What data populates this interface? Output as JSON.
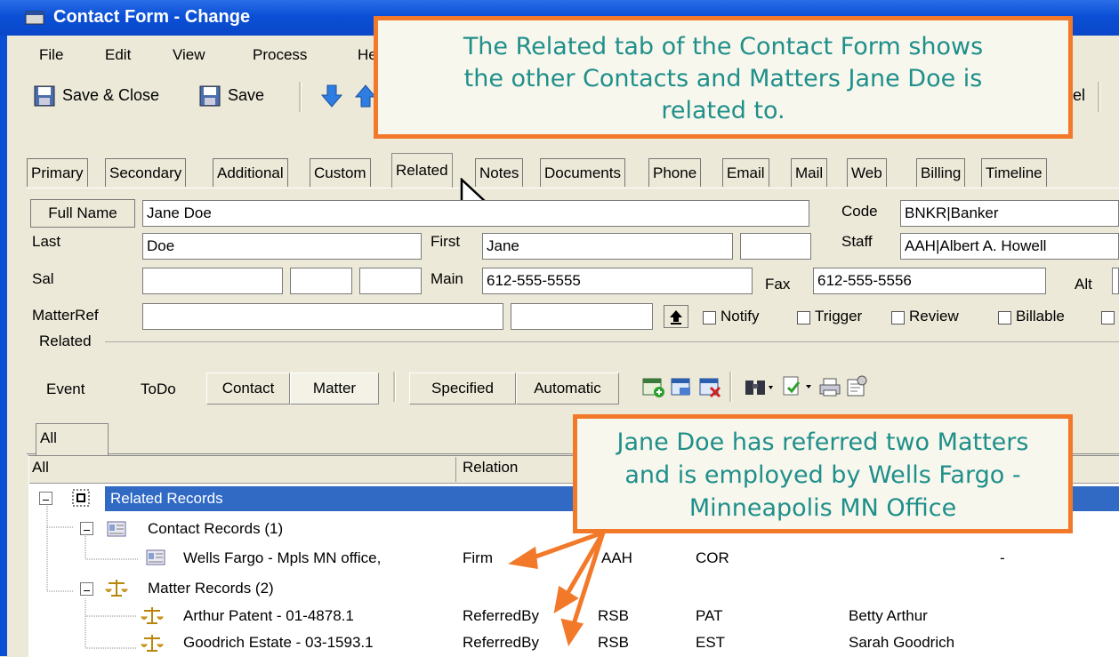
{
  "window": {
    "title": "Contact Form - Change"
  },
  "menu": [
    "File",
    "Edit",
    "View",
    "Process",
    "He"
  ],
  "toolbar": {
    "save_close": "Save & Close",
    "save": "Save",
    "right_label": "el"
  },
  "tabs": [
    "Primary",
    "Secondary",
    "Additional",
    "Custom",
    "Related",
    "Notes",
    "Documents",
    "Phone",
    "Email",
    "Mail",
    "Web",
    "Billing",
    "Timeline"
  ],
  "active_tab": "Related",
  "form": {
    "full_name_button": "Full Name",
    "full_name_value": "Jane Doe",
    "code_label": "Code",
    "code_value": "BNKR|Banker",
    "last_label": "Last",
    "last_value": "Doe",
    "first_label": "First",
    "first_value": "Jane",
    "staff_label": "Staff",
    "staff_value": "AAH|Albert A. Howell",
    "sal_label": "Sal",
    "main_label": "Main",
    "main_value": "612-555-5555",
    "fax_label": "Fax",
    "fax_value": "612-555-5556",
    "alt_label": "Alt",
    "matterref_label": "MatterRef",
    "checkboxes": [
      "Notify",
      "Trigger",
      "Review",
      "Billable"
    ]
  },
  "related": {
    "group_label": "Related",
    "event": "Event",
    "todo": "ToDo",
    "contact": "Contact",
    "matter": "Matter",
    "specified": "Specified",
    "automatic": "Automatic",
    "subtab": "All",
    "col_all": "All",
    "col_relation": "Relation",
    "root": "Related Records",
    "contact_group": "Contact Records (1)",
    "matter_group": "Matter Records (2)",
    "rows": [
      {
        "name": "Wells Fargo - Mpls MN office,",
        "relation": "Firm",
        "staff": "AAH",
        "code": "COR",
        "extra": "-"
      },
      {
        "name": "Arthur Patent - 01-4878.1",
        "relation": "ReferredBy",
        "staff": "RSB",
        "code": "PAT",
        "extra": "Betty Arthur"
      },
      {
        "name": "Goodrich Estate - 03-1593.1",
        "relation": "ReferredBy",
        "staff": "RSB",
        "code": "EST",
        "extra": "Sarah Goodrich"
      }
    ]
  },
  "callouts": {
    "top": [
      "The Related tab of the Contact Form shows",
      "the other Contacts and Matters Jane Doe is",
      "related to."
    ],
    "bottom": [
      "Jane Doe has referred two Matters",
      "and is employed by Wells Fargo -",
      "Minneapolis MN Office"
    ]
  },
  "colors": {
    "accent": "#f2792a",
    "callout_text": "#1f8f8a",
    "selection": "#316ac5",
    "titlebar": "#0b4fd6"
  }
}
